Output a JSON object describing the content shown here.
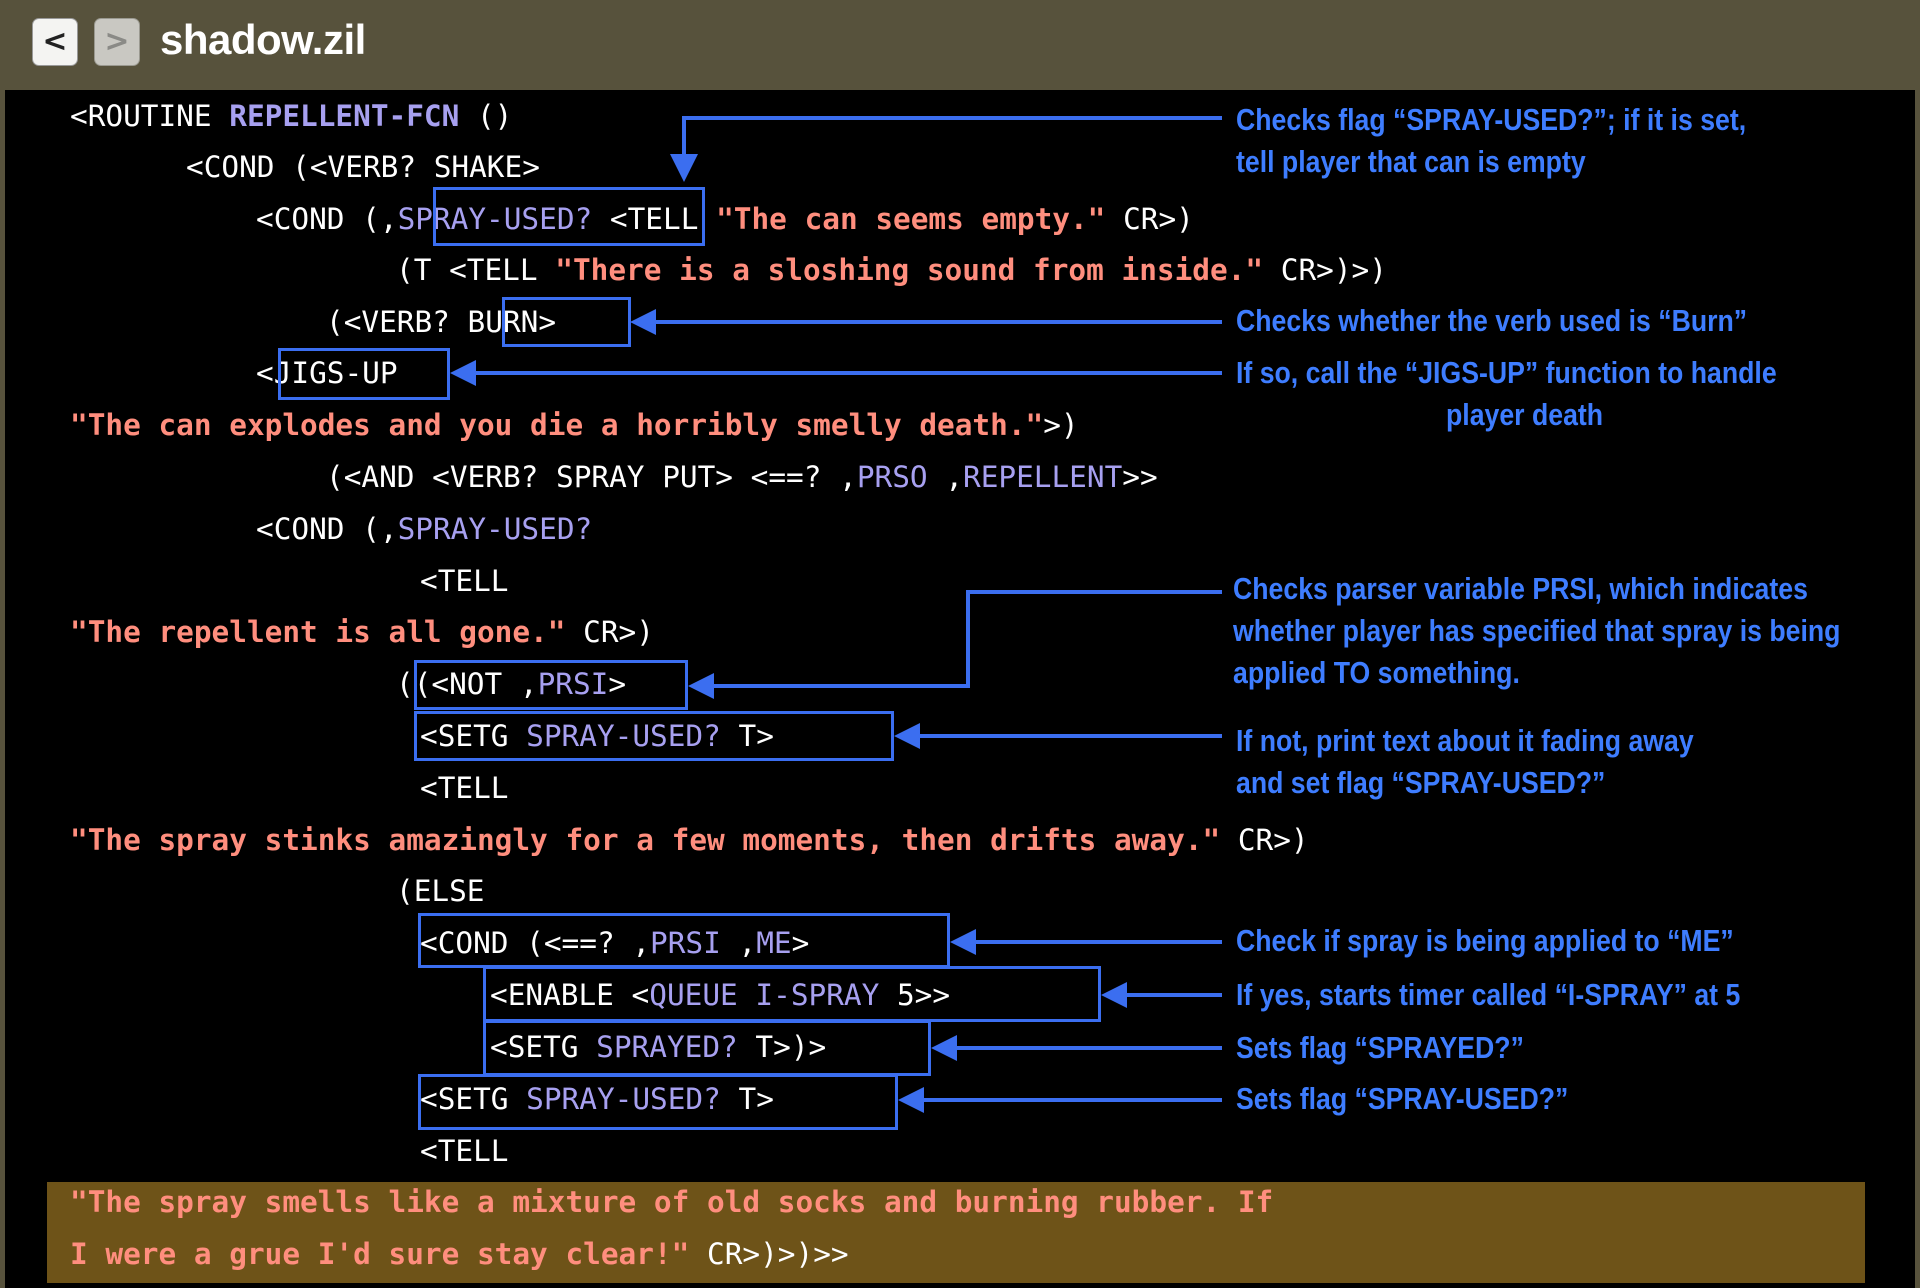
{
  "window": {
    "title": "shadow.zil",
    "back_label": "<",
    "forward_label": ">"
  },
  "code": {
    "l1": {
      "a": "<ROUTINE ",
      "b": "REPELLENT-FCN",
      "c": " ()"
    },
    "l2": {
      "a": "<COND (<VERB? SHAKE>"
    },
    "l3": {
      "a": "<COND (,",
      "b": "SPRAY-USED?",
      "c": " <TELL ",
      "d": "\"The can seems empty.\"",
      "e": " CR>)"
    },
    "l4": {
      "a": "(T <TELL ",
      "b": "\"There is a sloshing sound from inside.\"",
      "c": " CR>)>)"
    },
    "l5": {
      "a": "(<VERB? BURN>"
    },
    "l6": {
      "a": "<JIGS-UP"
    },
    "l7": {
      "a": "\"The can explodes and you die a horribly smelly death.\"",
      "b": ">)"
    },
    "l8": {
      "a": "(<AND <VERB? SPRAY PUT> <==? ,",
      "b": "PRSO",
      "c": " ,",
      "d": "REPELLENT",
      "e": ">>"
    },
    "l9": {
      "a": "<COND (,",
      "b": "SPRAY-USED?"
    },
    "l10": {
      "a": "<TELL"
    },
    "l11": {
      "a": "\"The repellent is all gone.\"",
      "b": " CR>)"
    },
    "l12": {
      "a": "(<NOT ,",
      "b": "PRSI",
      "c": ">"
    },
    "l13": {
      "a": "<SETG ",
      "b": "SPRAY-USED?",
      "c": " T>"
    },
    "l14": {
      "a": "<TELL"
    },
    "l15": {
      "a": "\"The spray stinks amazingly for a few moments, then drifts away.\"",
      "b": " CR>)"
    },
    "l16": {
      "a": "(ELSE"
    },
    "l17": {
      "a": "<COND (<==? ,",
      "b": "PRSI",
      "c": " ,",
      "d": "ME",
      "e": ">"
    },
    "l18": {
      "a": "<ENABLE <",
      "b": "QUEUE I-SPRAY",
      "c": " 5>>"
    },
    "l19": {
      "a": "<SETG ",
      "b": "SPRAYED?",
      "c": " T>)>"
    },
    "l20": {
      "a": "<SETG ",
      "b": "SPRAY-USED?",
      "c": " T>"
    },
    "l21": {
      "a": "<TELL"
    },
    "l22": {
      "a": "\"The spray smells like a mixture of old socks and burning rubber. If"
    },
    "l23": {
      "a": "I were a grue I'd sure stay clear!\"",
      "b": " CR>)>)>>"
    }
  },
  "annotations": {
    "spray_used_1": "Checks flag “SPRAY-USED?”; if it is set,",
    "spray_used_2": "tell player that can is empty",
    "burn": "Checks whether the verb used is “Burn”",
    "jigs_1": "If so, call the “JIGS-UP” function to handle",
    "jigs_2": "player death",
    "prsi_1": "Checks parser variable PRSI, which indicates",
    "prsi_2": "whether player has specified that spray is being",
    "prsi_3": "applied TO something.",
    "setg_1": "If not, print text about it fading away",
    "setg_2": "and set flag “SPRAY-USED?”",
    "me": "Check if spray is being applied to “ME”",
    "enable": "If yes, starts timer called “I-SPRAY” at 5",
    "sprayed": "Sets flag “SPRAYED?”",
    "spray_used_set": "Sets flag “SPRAY-USED?”"
  },
  "colors": {
    "titlebar": "#57523c",
    "annotation_blue": "#3e7dff",
    "string_salmon": "#ff8e7e",
    "variable_purple": "#a7a0f0",
    "highlight_band": "#6e5318"
  }
}
